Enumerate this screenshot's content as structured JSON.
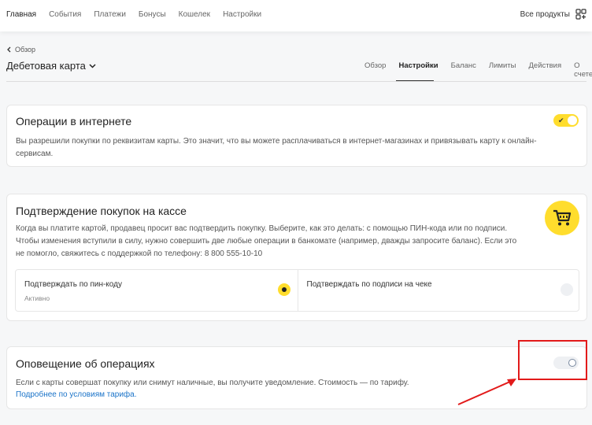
{
  "topnav": {
    "items": [
      "Главная",
      "События",
      "Платежи",
      "Бонусы",
      "Кошелек",
      "Настройки"
    ],
    "all_products": "Все продукты",
    "apps_icon": "apps-plus-icon"
  },
  "breadcrumb": {
    "back_label": "Обзор"
  },
  "page": {
    "title": "Дебетовая карта",
    "tabs": [
      "Обзор",
      "Настройки",
      "Баланс",
      "Лимиты",
      "Действия",
      "О счете"
    ],
    "active_tab": "Настройки"
  },
  "online": {
    "title": "Операции в интернете",
    "text_line1": "Вы разрешили покупки по реквизитам карты. Это значит, что вы можете расплачиваться в интернет-магазинах и привязывать карту к онлайн-",
    "text_line2": "сервисам.",
    "toggle_on": true
  },
  "pos": {
    "title": "Подтверждение покупок на кассе",
    "text_line1": "Когда вы платите картой, продавец просит вас подтвердить покупку. Выберите, как это делать: с помощью ПИН-кода или по подписи.",
    "text_line2": "Чтобы изменения вступили в силу, нужно совершить две любые операции в банкомате (например, дважды запросите баланс). Если это",
    "text_line3": "не помогло, свяжитесь с поддержкой по телефону: 8 800 555-10-10",
    "icon": "shopping-cart-icon",
    "options": [
      {
        "label": "Подтверждать по пин-коду",
        "status": "Активно",
        "selected": true
      },
      {
        "label": "Подтверждать по подписи на чеке",
        "status": "",
        "selected": false
      }
    ]
  },
  "notify": {
    "title": "Оповещение об операциях",
    "text": "Если с карты совершат покупку или снимут наличные, вы получите уведомление. Стоимость — по тарифу.",
    "link": "Подробнее по условиям тарифа.",
    "toggle_on": false
  },
  "colors": {
    "accent": "#ffdd2d",
    "link": "#1a73c8",
    "annotation": "#e21a1a"
  }
}
